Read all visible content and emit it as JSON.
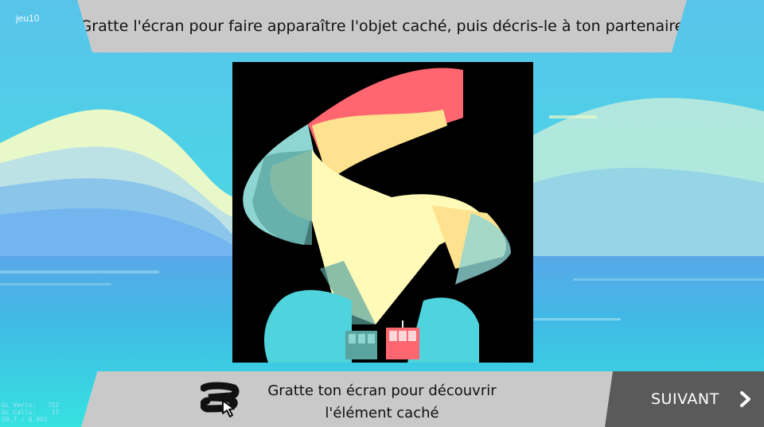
{
  "game": {
    "instruction": "Gratte l'écran pour faire apparaître l'objet caché, puis décris-le à ton partenaire",
    "corner_label": "jeu10",
    "hint": "Gratte ton écran pour découvrir\nl'élément caché",
    "next_label": "SUIVANT",
    "debug_lines": [
      "GL Verts:   752",
      "GL Calls:    17",
      "59.7 / 0.001"
    ]
  },
  "colors": {
    "banner": "#c9c9c9",
    "next_button": "#5a5a5a",
    "sea": "#3fd9e0",
    "sky_top": "#5ec8ec",
    "red": "#ff6670",
    "yellow": "#ffe28f",
    "cream": "#fffab8",
    "teal": "#5aa4a0"
  },
  "icons": {
    "hint": "hand-scratch-icon",
    "next": "chevron-right-icon",
    "cablecar": "cable-car-icon"
  }
}
